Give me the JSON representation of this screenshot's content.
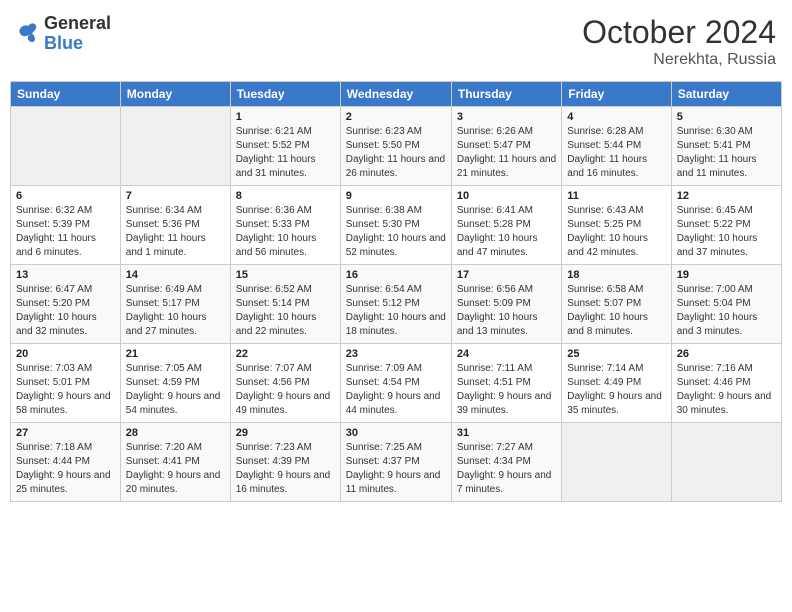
{
  "header": {
    "logo": {
      "general": "General",
      "blue": "Blue"
    },
    "title": "October 2024",
    "location": "Nerekhta, Russia"
  },
  "weekdays": [
    "Sunday",
    "Monday",
    "Tuesday",
    "Wednesday",
    "Thursday",
    "Friday",
    "Saturday"
  ],
  "weeks": [
    [
      {
        "day": "",
        "info": ""
      },
      {
        "day": "",
        "info": ""
      },
      {
        "day": "1",
        "info": "Sunrise: 6:21 AM\nSunset: 5:52 PM\nDaylight: 11 hours and 31 minutes."
      },
      {
        "day": "2",
        "info": "Sunrise: 6:23 AM\nSunset: 5:50 PM\nDaylight: 11 hours and 26 minutes."
      },
      {
        "day": "3",
        "info": "Sunrise: 6:26 AM\nSunset: 5:47 PM\nDaylight: 11 hours and 21 minutes."
      },
      {
        "day": "4",
        "info": "Sunrise: 6:28 AM\nSunset: 5:44 PM\nDaylight: 11 hours and 16 minutes."
      },
      {
        "day": "5",
        "info": "Sunrise: 6:30 AM\nSunset: 5:41 PM\nDaylight: 11 hours and 11 minutes."
      }
    ],
    [
      {
        "day": "6",
        "info": "Sunrise: 6:32 AM\nSunset: 5:39 PM\nDaylight: 11 hours and 6 minutes."
      },
      {
        "day": "7",
        "info": "Sunrise: 6:34 AM\nSunset: 5:36 PM\nDaylight: 11 hours and 1 minute."
      },
      {
        "day": "8",
        "info": "Sunrise: 6:36 AM\nSunset: 5:33 PM\nDaylight: 10 hours and 56 minutes."
      },
      {
        "day": "9",
        "info": "Sunrise: 6:38 AM\nSunset: 5:30 PM\nDaylight: 10 hours and 52 minutes."
      },
      {
        "day": "10",
        "info": "Sunrise: 6:41 AM\nSunset: 5:28 PM\nDaylight: 10 hours and 47 minutes."
      },
      {
        "day": "11",
        "info": "Sunrise: 6:43 AM\nSunset: 5:25 PM\nDaylight: 10 hours and 42 minutes."
      },
      {
        "day": "12",
        "info": "Sunrise: 6:45 AM\nSunset: 5:22 PM\nDaylight: 10 hours and 37 minutes."
      }
    ],
    [
      {
        "day": "13",
        "info": "Sunrise: 6:47 AM\nSunset: 5:20 PM\nDaylight: 10 hours and 32 minutes."
      },
      {
        "day": "14",
        "info": "Sunrise: 6:49 AM\nSunset: 5:17 PM\nDaylight: 10 hours and 27 minutes."
      },
      {
        "day": "15",
        "info": "Sunrise: 6:52 AM\nSunset: 5:14 PM\nDaylight: 10 hours and 22 minutes."
      },
      {
        "day": "16",
        "info": "Sunrise: 6:54 AM\nSunset: 5:12 PM\nDaylight: 10 hours and 18 minutes."
      },
      {
        "day": "17",
        "info": "Sunrise: 6:56 AM\nSunset: 5:09 PM\nDaylight: 10 hours and 13 minutes."
      },
      {
        "day": "18",
        "info": "Sunrise: 6:58 AM\nSunset: 5:07 PM\nDaylight: 10 hours and 8 minutes."
      },
      {
        "day": "19",
        "info": "Sunrise: 7:00 AM\nSunset: 5:04 PM\nDaylight: 10 hours and 3 minutes."
      }
    ],
    [
      {
        "day": "20",
        "info": "Sunrise: 7:03 AM\nSunset: 5:01 PM\nDaylight: 9 hours and 58 minutes."
      },
      {
        "day": "21",
        "info": "Sunrise: 7:05 AM\nSunset: 4:59 PM\nDaylight: 9 hours and 54 minutes."
      },
      {
        "day": "22",
        "info": "Sunrise: 7:07 AM\nSunset: 4:56 PM\nDaylight: 9 hours and 49 minutes."
      },
      {
        "day": "23",
        "info": "Sunrise: 7:09 AM\nSunset: 4:54 PM\nDaylight: 9 hours and 44 minutes."
      },
      {
        "day": "24",
        "info": "Sunrise: 7:11 AM\nSunset: 4:51 PM\nDaylight: 9 hours and 39 minutes."
      },
      {
        "day": "25",
        "info": "Sunrise: 7:14 AM\nSunset: 4:49 PM\nDaylight: 9 hours and 35 minutes."
      },
      {
        "day": "26",
        "info": "Sunrise: 7:16 AM\nSunset: 4:46 PM\nDaylight: 9 hours and 30 minutes."
      }
    ],
    [
      {
        "day": "27",
        "info": "Sunrise: 7:18 AM\nSunset: 4:44 PM\nDaylight: 9 hours and 25 minutes."
      },
      {
        "day": "28",
        "info": "Sunrise: 7:20 AM\nSunset: 4:41 PM\nDaylight: 9 hours and 20 minutes."
      },
      {
        "day": "29",
        "info": "Sunrise: 7:23 AM\nSunset: 4:39 PM\nDaylight: 9 hours and 16 minutes."
      },
      {
        "day": "30",
        "info": "Sunrise: 7:25 AM\nSunset: 4:37 PM\nDaylight: 9 hours and 11 minutes."
      },
      {
        "day": "31",
        "info": "Sunrise: 7:27 AM\nSunset: 4:34 PM\nDaylight: 9 hours and 7 minutes."
      },
      {
        "day": "",
        "info": ""
      },
      {
        "day": "",
        "info": ""
      }
    ]
  ]
}
